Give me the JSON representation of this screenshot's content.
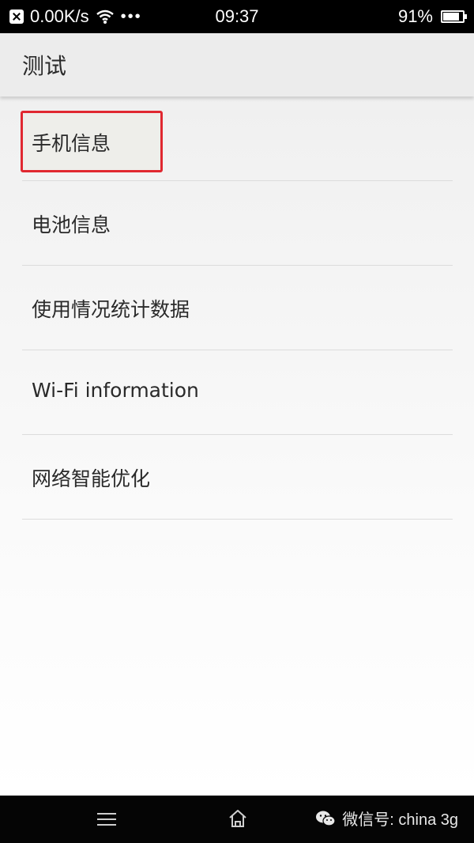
{
  "status_bar": {
    "network_speed": "0.00K/s",
    "more_dots": "•••",
    "time": "09:37",
    "battery_percent": "91%",
    "battery_level": 0.91
  },
  "header": {
    "title": "测试"
  },
  "list": {
    "items": [
      {
        "label": "手机信息"
      },
      {
        "label": "电池信息"
      },
      {
        "label": "使用情况统计数据"
      },
      {
        "label": "Wi-Fi information"
      },
      {
        "label": "网络智能优化"
      }
    ]
  },
  "nav_bar": {
    "watermark_text": "微信号: china 3g",
    "icons": [
      "menu-icon",
      "home-icon",
      "wechat-icon"
    ]
  },
  "colors": {
    "highlight_border": "#e02830",
    "status_bar_bg": "#000000"
  }
}
